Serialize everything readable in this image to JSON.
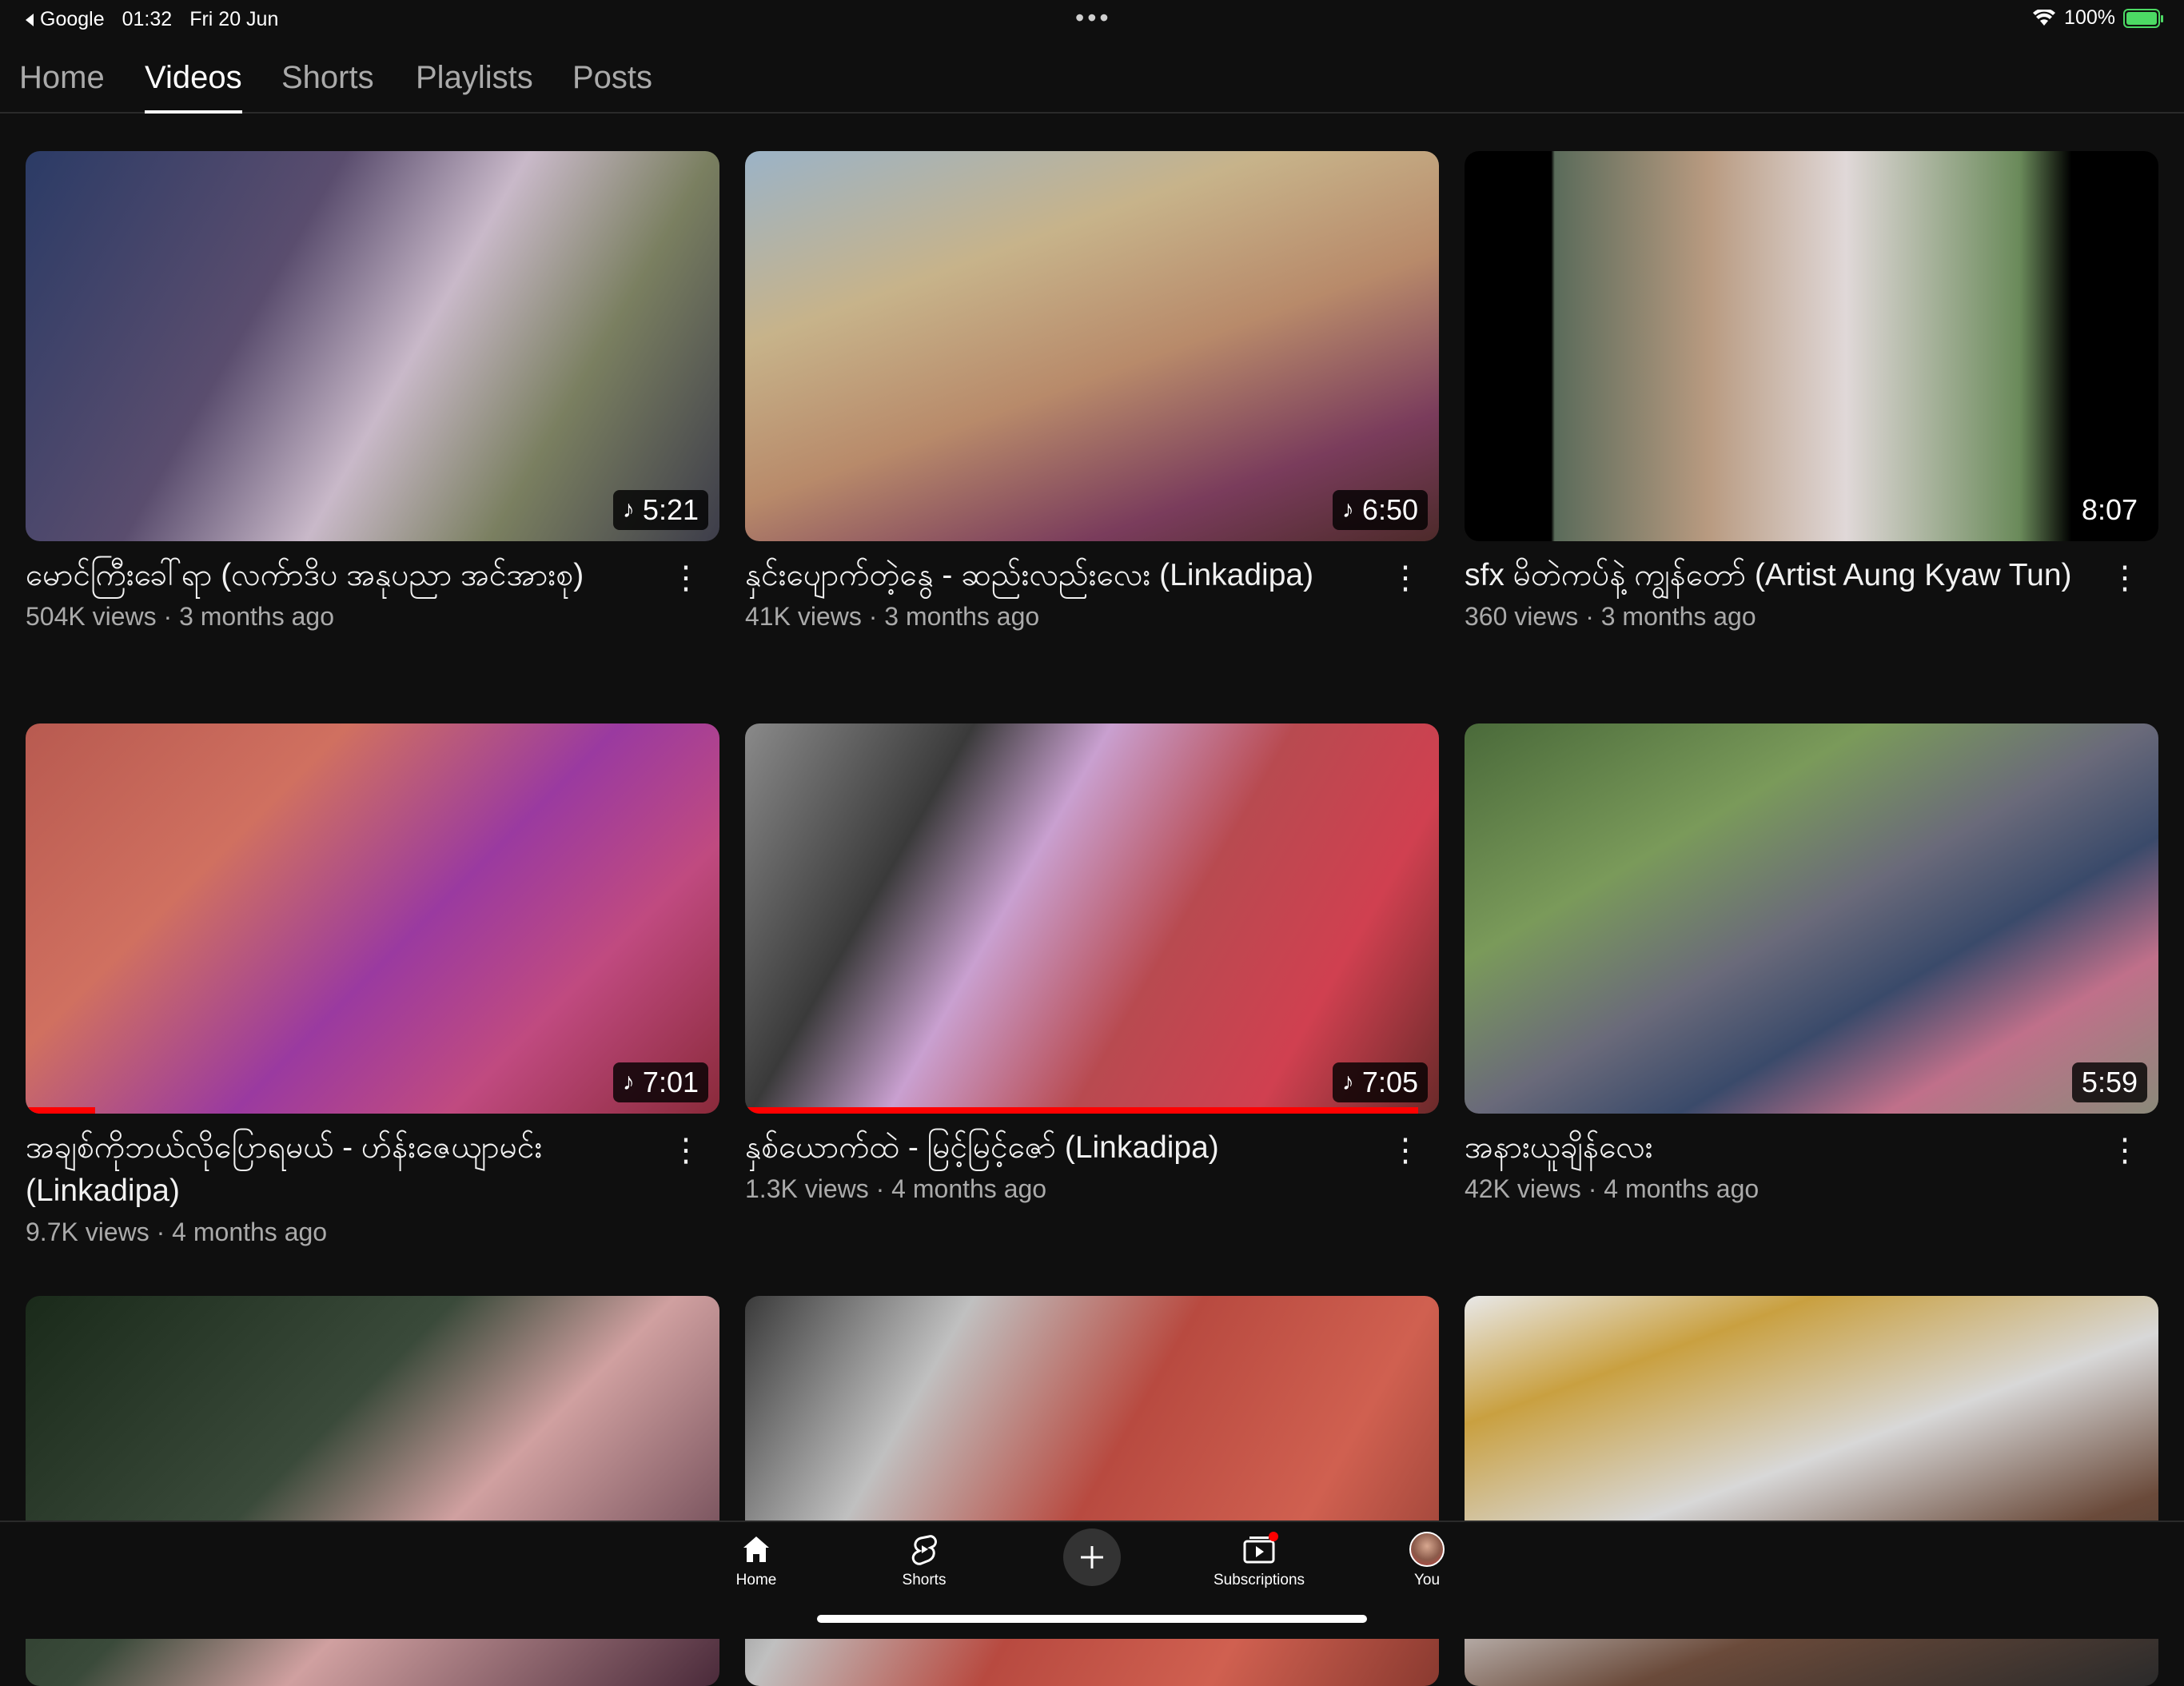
{
  "status_bar": {
    "back_app": "Google",
    "time": "01:32",
    "date": "Fri 20 Jun",
    "battery": "100%",
    "icons": [
      "wifi-icon",
      "battery-charging-icon"
    ]
  },
  "tabs": [
    {
      "label": "Home"
    },
    {
      "label": "Videos",
      "active": true
    },
    {
      "label": "Shorts"
    },
    {
      "label": "Playlists"
    },
    {
      "label": "Posts"
    }
  ],
  "videos": [
    {
      "title": "မောင်ကြီးခေါ်ရာ (လက်ာဒိပ အနုပညာ အင်အားစု)",
      "views": "504K views",
      "age": "3 months ago",
      "duration": "5:21",
      "music": true
    },
    {
      "title": "နှင်းပျောက်တဲ့နွေ - ဆည်းလည်းလေး (Linkadipa)",
      "views": "41K views",
      "age": "3 months ago",
      "duration": "6:50",
      "music": true
    },
    {
      "title": "sfx မိတဲကပ်နဲ့ ကျွန်တော် (Artist Aung Kyaw Tun)",
      "views": "360 views",
      "age": "3 months ago",
      "duration": "8:07",
      "music": false
    },
    {
      "title": "အချစ်ကိုဘယ်လိုပြောရမယ် - ဟ်န်းဇေယျာမင်း (Linkadipa)",
      "views": "9.7K views",
      "age": "4 months ago",
      "duration": "7:01",
      "music": true,
      "watched": 0.1
    },
    {
      "title": "နှစ်ယောက်ထဲ - မြင့်မြင့်ဇော် (Linkadipa)",
      "views": "1.3K views",
      "age": "4 months ago",
      "duration": "7:05",
      "music": true,
      "watched": 0.97
    },
    {
      "title": "အနားယူချိန်လေး",
      "views": "42K views",
      "age": "4 months ago",
      "duration": "5:59",
      "music": false
    }
  ],
  "bottom_nav": {
    "home": "Home",
    "shorts": "Shorts",
    "subscriptions": "Subscriptions",
    "you": "You"
  },
  "colors": {
    "background": "#0f0f0f",
    "text_primary": "#f1f1f1",
    "text_secondary": "#aaaaaa",
    "progress": "#ff0000"
  }
}
